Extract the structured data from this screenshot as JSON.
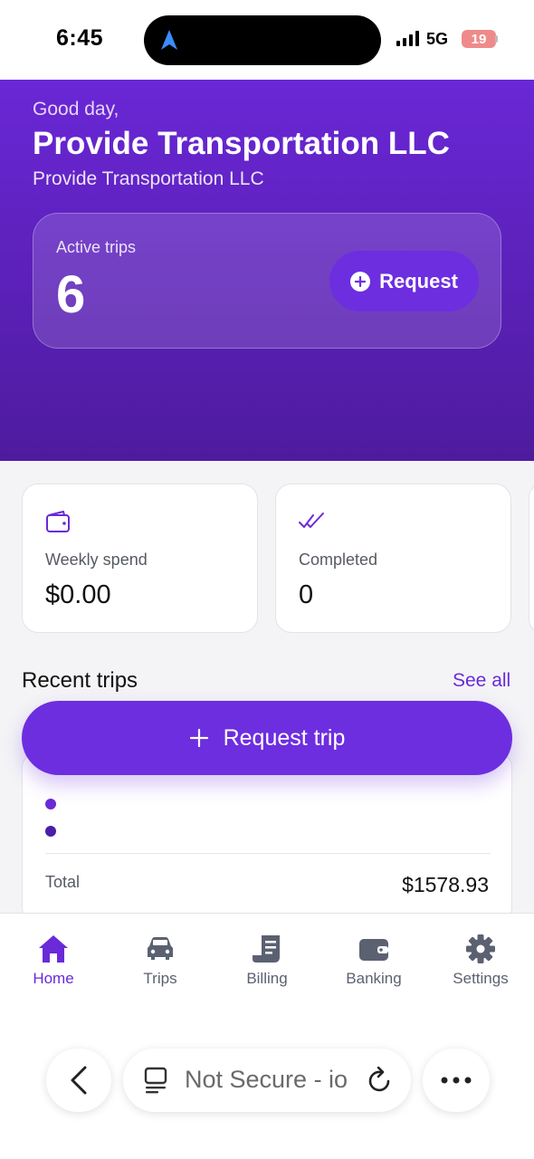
{
  "status_bar": {
    "time": "6:45",
    "network": "5G",
    "battery": "19"
  },
  "hero": {
    "greeting": "Good day,",
    "title": "Provide Transportation LLC",
    "subtitle": "Provide Transportation LLC",
    "active_trips_label": "Active trips",
    "active_trips_count": "6",
    "request_label": "Request"
  },
  "stats": [
    {
      "icon": "wallet-icon",
      "label": "Weekly spend",
      "value": "$0.00"
    },
    {
      "icon": "double-check-icon",
      "label": "Completed",
      "value": "0"
    }
  ],
  "recent": {
    "title": "Recent trips",
    "see_all": "See all",
    "request_trip_label": "Request trip",
    "trip": {
      "total_label": "Total",
      "total_value": "$1578.93"
    }
  },
  "nav": [
    {
      "label": "Home",
      "icon": "home-icon",
      "active": true
    },
    {
      "label": "Trips",
      "icon": "car-icon"
    },
    {
      "label": "Billing",
      "icon": "receipt-icon"
    },
    {
      "label": "Banking",
      "icon": "wallet-icon"
    },
    {
      "label": "Settings",
      "icon": "gear-icon"
    }
  ],
  "browser": {
    "url_text": "Not Secure - io"
  },
  "colors": {
    "accent": "#6a2ad8",
    "hero_top": "#6a27d6",
    "hero_bottom": "#4e1b9e"
  }
}
